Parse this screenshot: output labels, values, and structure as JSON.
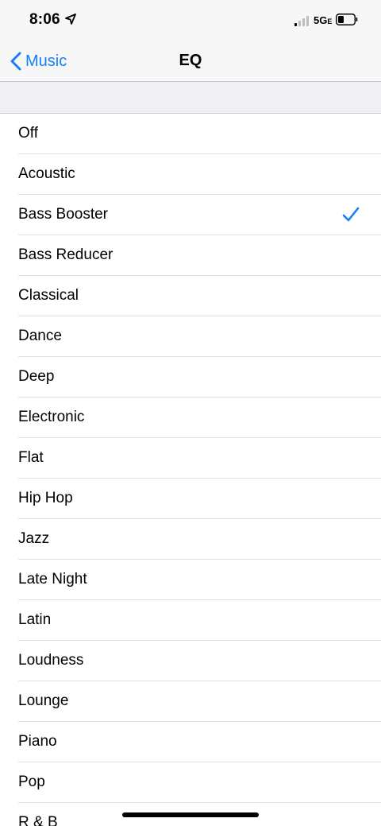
{
  "status_bar": {
    "time": "8:06",
    "network": "5G",
    "network_suffix": "E"
  },
  "nav": {
    "back_label": "Music",
    "title": "EQ"
  },
  "accent_color": "#147efb",
  "eq_presets": [
    {
      "label": "Off",
      "selected": false
    },
    {
      "label": "Acoustic",
      "selected": false
    },
    {
      "label": "Bass Booster",
      "selected": true
    },
    {
      "label": "Bass Reducer",
      "selected": false
    },
    {
      "label": "Classical",
      "selected": false
    },
    {
      "label": "Dance",
      "selected": false
    },
    {
      "label": "Deep",
      "selected": false
    },
    {
      "label": "Electronic",
      "selected": false
    },
    {
      "label": "Flat",
      "selected": false
    },
    {
      "label": "Hip Hop",
      "selected": false
    },
    {
      "label": "Jazz",
      "selected": false
    },
    {
      "label": "Late Night",
      "selected": false
    },
    {
      "label": "Latin",
      "selected": false
    },
    {
      "label": "Loudness",
      "selected": false
    },
    {
      "label": "Lounge",
      "selected": false
    },
    {
      "label": "Piano",
      "selected": false
    },
    {
      "label": "Pop",
      "selected": false
    },
    {
      "label": "R & B",
      "selected": false
    }
  ]
}
